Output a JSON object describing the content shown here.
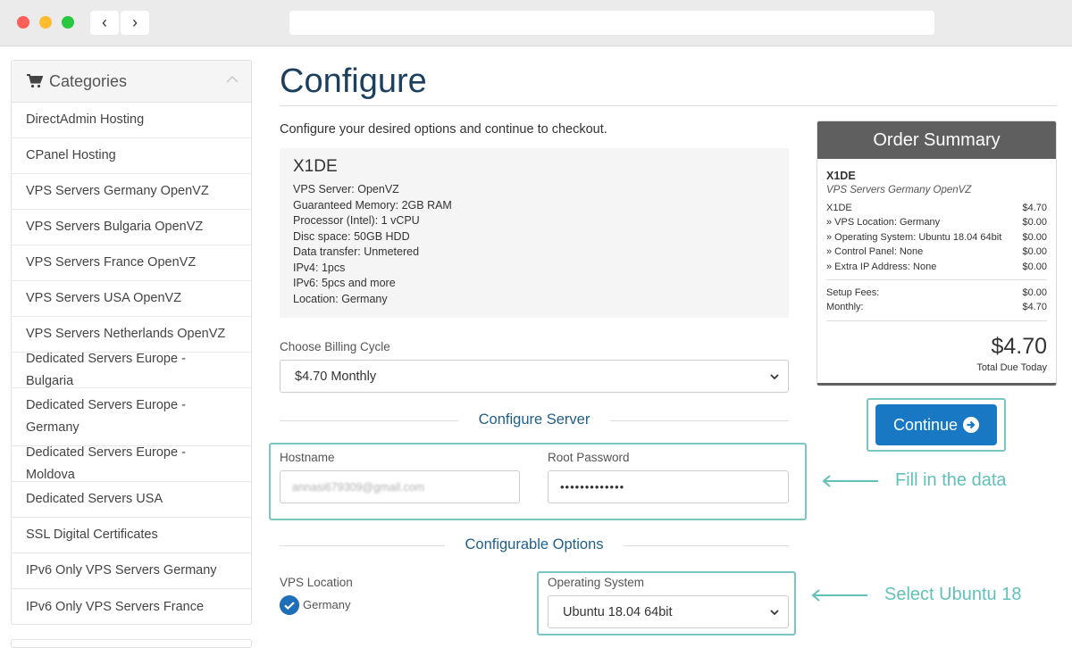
{
  "browser": {
    "back_glyph": "‹",
    "forward_glyph": "›"
  },
  "sidebar": {
    "title": "Categories",
    "icon": "shopping-cart-icon",
    "items": [
      {
        "label": "DirectAdmin Hosting"
      },
      {
        "label": "CPanel Hosting"
      },
      {
        "label": "VPS Servers Germany OpenVZ"
      },
      {
        "label": "VPS Servers Bulgaria OpenVZ"
      },
      {
        "label": "VPS Servers France OpenVZ"
      },
      {
        "label": "VPS Servers USA OpenVZ"
      },
      {
        "label": "VPS Servers Netherlands OpenVZ"
      },
      {
        "label": "Dedicated Servers Europe - Bulgaria"
      },
      {
        "label": "Dedicated Servers Europe - Germany"
      },
      {
        "label": "Dedicated Servers Europe - Moldova"
      },
      {
        "label": "Dedicated Servers USA"
      },
      {
        "label": "SSL Digital Certificates"
      },
      {
        "label": "IPv6 Only VPS Servers Germany"
      },
      {
        "label": "IPv6 Only VPS Servers France"
      }
    ]
  },
  "main": {
    "title": "Configure",
    "intro": "Configure your desired options and continue to checkout.",
    "product": {
      "name": "X1DE",
      "features": [
        "VPS Server: OpenVZ",
        "Guaranteed Memory: 2GB RAM",
        "Processor (Intel): 1 vCPU",
        "Disc space: 50GB HDD",
        "Data transfer: Unmetered",
        "IPv4: 1pcs",
        "IPv6: 5pcs and more",
        "Location: Germany"
      ]
    },
    "billing": {
      "label": "Choose Billing Cycle",
      "value": "$4.70 Monthly"
    },
    "configure_server": {
      "heading": "Configure Server",
      "hostname_label": "Hostname",
      "hostname_value": "annasi679309@gmail.com",
      "password_label": "Root Password",
      "password_value": "•••••••••••••"
    },
    "configurable_options": {
      "heading": "Configurable Options",
      "vps_location_label": "VPS Location",
      "vps_location_value": "Germany",
      "os_label": "Operating System",
      "os_value": "Ubuntu 18.04 64bit"
    }
  },
  "summary": {
    "title": "Order Summary",
    "product": "X1DE",
    "group": "VPS Servers Germany OpenVZ",
    "lines": [
      {
        "label": "X1DE",
        "value": "$4.70"
      },
      {
        "label": "» VPS Location: Germany",
        "value": "$0.00"
      },
      {
        "label": "» Operating System: Ubuntu 18.04 64bit",
        "value": "$0.00"
      },
      {
        "label": "» Control Panel: None",
        "value": "$0.00"
      },
      {
        "label": "» Extra IP Address: None",
        "value": "$0.00"
      }
    ],
    "setup_fees_label": "Setup Fees:",
    "setup_fees_value": "$0.00",
    "monthly_label": "Monthly:",
    "monthly_value": "$4.70",
    "total": "$4.70",
    "total_label": "Total Due Today"
  },
  "continue_button": {
    "label": "Continue"
  },
  "annotations": {
    "fill_data": "Fill in the data",
    "select_ubuntu": "Select Ubuntu 18"
  },
  "colors": {
    "accent": "#1978c4",
    "highlight": "#7ac6c1",
    "callout_text": "#62c0ba",
    "title": "#1c3f5e",
    "summary_header": "#5f5f5f"
  }
}
